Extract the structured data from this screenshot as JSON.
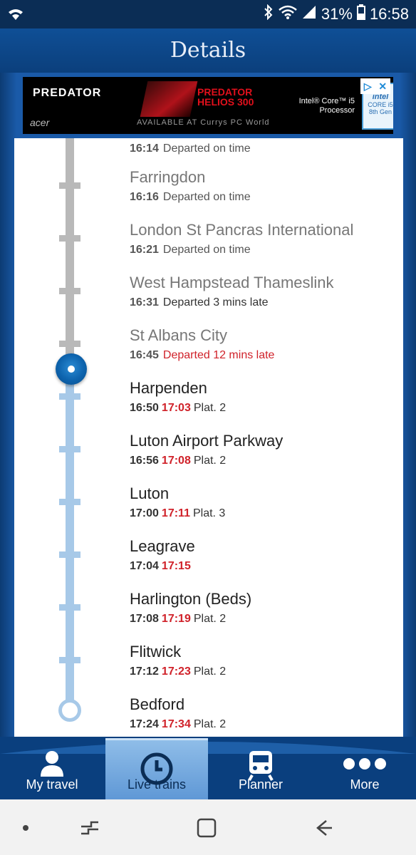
{
  "status_bar": {
    "battery": "31%",
    "time": "16:58"
  },
  "header": {
    "title": "Details"
  },
  "ad": {
    "brand": "PREDATOR",
    "maker": "acer",
    "product_title_1": "PREDATOR",
    "product_title_2": "HELIOS 300",
    "intel_line_1": "Intel® Core™ i5",
    "intel_line_2": "Processor",
    "available": "AVAILABLE AT Currys PC World",
    "badge_1": "intel",
    "badge_2": "CORE i5",
    "badge_3": "8th Gen"
  },
  "stops": [
    {
      "name": "",
      "scheduled": "16:14",
      "status": "Departed on time",
      "status_type": "normal",
      "expected": "",
      "platform": ""
    },
    {
      "name": "Farringdon",
      "scheduled": "16:16",
      "status": "Departed on time",
      "status_type": "normal",
      "expected": "",
      "platform": ""
    },
    {
      "name": "London St Pancras International",
      "scheduled": "16:21",
      "status": "Departed on time",
      "status_type": "normal",
      "expected": "",
      "platform": ""
    },
    {
      "name": "West Hampstead Thameslink",
      "scheduled": "16:31",
      "status": "Departed 3 mins late",
      "status_type": "dark",
      "expected": "",
      "platform": ""
    },
    {
      "name": "St Albans City",
      "scheduled": "16:45",
      "status": "Departed 12 mins late",
      "status_type": "late",
      "expected": "",
      "platform": ""
    },
    {
      "name": "Harpenden",
      "scheduled": "16:50",
      "status": "",
      "expected": "17:03",
      "platform": "Plat. 2"
    },
    {
      "name": "Luton Airport Parkway",
      "scheduled": "16:56",
      "status": "",
      "expected": "17:08",
      "platform": "Plat. 2"
    },
    {
      "name": "Luton",
      "scheduled": "17:00",
      "status": "",
      "expected": "17:11",
      "platform": "Plat. 3"
    },
    {
      "name": "Leagrave",
      "scheduled": "17:04",
      "status": "",
      "expected": "17:15",
      "platform": ""
    },
    {
      "name": "Harlington (Beds)",
      "scheduled": "17:08",
      "status": "",
      "expected": "17:19",
      "platform": "Plat. 2"
    },
    {
      "name": "Flitwick",
      "scheduled": "17:12",
      "status": "",
      "expected": "17:23",
      "platform": "Plat. 2"
    },
    {
      "name": "Bedford",
      "scheduled": "17:24",
      "status": "",
      "expected": "17:34",
      "platform": "Plat. 2"
    }
  ],
  "bottom_nav": [
    {
      "label": "My travel",
      "icon": "person-icon"
    },
    {
      "label": "Live trains",
      "icon": "clock-icon"
    },
    {
      "label": "Planner",
      "icon": "train-icon"
    },
    {
      "label": "More",
      "icon": "more-icon"
    }
  ]
}
